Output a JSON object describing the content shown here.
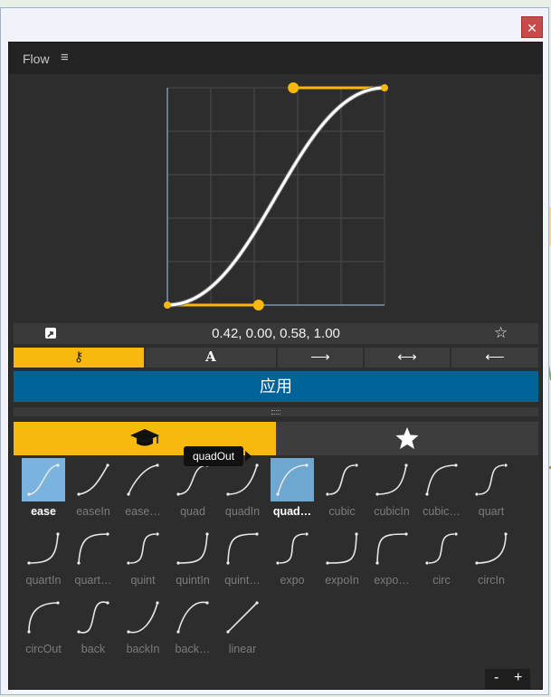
{
  "window": {
    "close_glyph": "✕"
  },
  "panel": {
    "title": "Flow",
    "menu_icon": "hamburger-icon"
  },
  "curve": {
    "control_points": [
      0.42,
      0.0,
      0.58,
      1.0
    ],
    "accent_color": "#f7b90c",
    "curve_color": "#ffffff",
    "axis_color": "#a8c8e8"
  },
  "valuebar": {
    "values_text": "0.42, 0.00, 0.58, 1.00",
    "export_icon": "export-icon",
    "favorite_icon": "star-outline-icon"
  },
  "modes": [
    {
      "icon": "key-icon",
      "glyph": "⚷",
      "active": true
    },
    {
      "icon": "text-icon",
      "glyph": "A",
      "active": false
    },
    {
      "icon": "arrow-right-icon",
      "glyph": "⟶",
      "active": false
    },
    {
      "icon": "arrow-both-icon",
      "glyph": "⟷",
      "active": false
    },
    {
      "icon": "arrow-left-icon",
      "glyph": "⟵",
      "active": false
    }
  ],
  "apply_label": "应用",
  "tabs": [
    {
      "icon": "graduation-cap-icon",
      "active": true
    },
    {
      "icon": "star-icon",
      "active": false
    }
  ],
  "presets": [
    {
      "label": "ease",
      "state": "selected"
    },
    {
      "label": "easeIn",
      "state": ""
    },
    {
      "label": "ease…",
      "state": ""
    },
    {
      "label": "quad",
      "state": ""
    },
    {
      "label": "quadIn",
      "state": ""
    },
    {
      "label": "quad…",
      "state": "hover"
    },
    {
      "label": "cubic",
      "state": ""
    },
    {
      "label": "cubicIn",
      "state": ""
    },
    {
      "label": "cubic…",
      "state": ""
    },
    {
      "label": "quart",
      "state": ""
    },
    {
      "label": "quartIn",
      "state": ""
    },
    {
      "label": "quart…",
      "state": ""
    },
    {
      "label": "quint",
      "state": ""
    },
    {
      "label": "quintIn",
      "state": ""
    },
    {
      "label": "quint…",
      "state": ""
    },
    {
      "label": "expo",
      "state": ""
    },
    {
      "label": "expoIn",
      "state": ""
    },
    {
      "label": "expo…",
      "state": ""
    },
    {
      "label": "circ",
      "state": ""
    },
    {
      "label": "circIn",
      "state": ""
    },
    {
      "label": "circOut",
      "state": ""
    },
    {
      "label": "back",
      "state": ""
    },
    {
      "label": "backIn",
      "state": ""
    },
    {
      "label": "back…",
      "state": ""
    },
    {
      "label": "linear",
      "state": ""
    }
  ],
  "tooltip": "quadOut",
  "zoom": {
    "minus": "-",
    "plus": "+"
  }
}
